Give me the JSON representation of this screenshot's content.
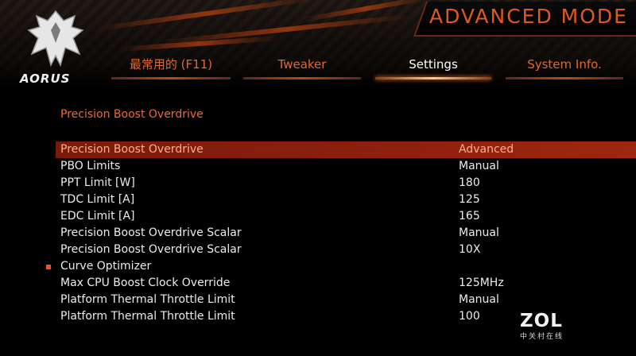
{
  "header": {
    "mode_title": "ADVANCED MODE",
    "brand": "AORUS"
  },
  "tabs": [
    {
      "label": "最常用的 (F11)",
      "active": false
    },
    {
      "label": "Tweaker",
      "active": false
    },
    {
      "label": "Settings",
      "active": true
    },
    {
      "label": "System Info.",
      "active": false
    }
  ],
  "section_title": "Precision Boost Overdrive",
  "settings": [
    {
      "label": "Precision Boost Overdrive",
      "value": "Advanced"
    },
    {
      "label": "PBO Limits",
      "value": "Manual"
    },
    {
      "label": "PPT Limit [W]",
      "value": "180"
    },
    {
      "label": "TDC Limit [A]",
      "value": "125"
    },
    {
      "label": "EDC Limit [A]",
      "value": "165"
    },
    {
      "label": "Precision Boost Overdrive Scalar",
      "value": "Manual"
    },
    {
      "label": "Precision Boost Overdrive Scalar",
      "value": "10X"
    },
    {
      "label": "Curve Optimizer",
      "value": ""
    },
    {
      "label": "Max CPU Boost Clock Override",
      "value": "125MHz"
    },
    {
      "label": "Platform Thermal Throttle Limit",
      "value": "Manual"
    },
    {
      "label": "Platform Thermal Throttle Limit",
      "value": "100"
    }
  ],
  "watermark": {
    "big": "ZOL",
    "small": "中关村在线"
  },
  "colors": {
    "accent": "#e1581d",
    "selected_row": "#8e200f",
    "background": "#000000"
  }
}
